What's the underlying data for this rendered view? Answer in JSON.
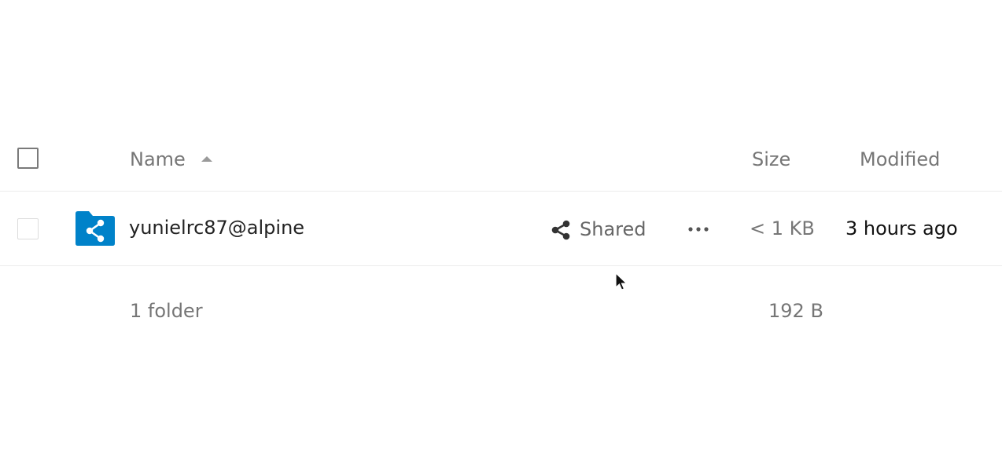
{
  "table": {
    "columns": {
      "name": "Name",
      "size": "Size",
      "modified": "Modified"
    },
    "sort": {
      "column": "name",
      "direction": "ascending",
      "icon": "sort-ascending-icon"
    }
  },
  "rows": [
    {
      "name": "yunielrc87@alpine",
      "icon": "shared-folder-icon",
      "share_label": "Shared",
      "size": "< 1 KB",
      "modified": "3 hours ago"
    }
  ],
  "summary": {
    "count": "1 folder",
    "size": "192 B"
  },
  "colors": {
    "folder_blue": "#0082c9",
    "header_text": "#767676",
    "primary_text": "#222222"
  }
}
